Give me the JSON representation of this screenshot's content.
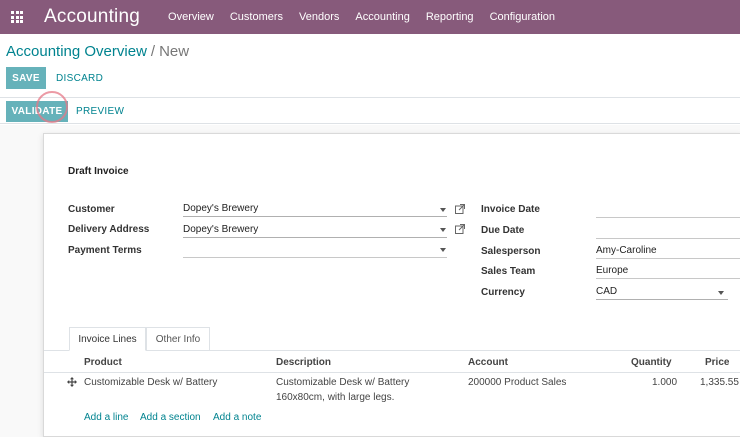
{
  "navbar": {
    "app_title": "Accounting",
    "menu": [
      "Overview",
      "Customers",
      "Vendors",
      "Accounting",
      "Reporting",
      "Configuration"
    ]
  },
  "breadcrumb": {
    "parent": "Accounting Overview",
    "separator": "/",
    "current": "New"
  },
  "buttons": {
    "save": "SAVE",
    "discard": "DISCARD",
    "validate": "VALIDATE",
    "preview": "PREVIEW"
  },
  "form": {
    "title": "Draft Invoice",
    "customer": {
      "label": "Customer",
      "value": "Dopey's Brewery"
    },
    "delivery_address": {
      "label": "Delivery Address",
      "value": "Dopey's Brewery"
    },
    "payment_terms": {
      "label": "Payment Terms",
      "value": ""
    },
    "invoice_date": {
      "label": "Invoice Date",
      "value": ""
    },
    "due_date": {
      "label": "Due Date",
      "value": ""
    },
    "salesperson": {
      "label": "Salesperson",
      "value": "Amy-Caroline"
    },
    "sales_team": {
      "label": "Sales Team",
      "value": "Europe"
    },
    "currency": {
      "label": "Currency",
      "value": "CAD"
    }
  },
  "tabs": [
    "Invoice Lines",
    "Other Info"
  ],
  "lines": {
    "headers": {
      "product": "Product",
      "description": "Description",
      "account": "Account",
      "quantity": "Quantity",
      "price": "Price"
    },
    "rows": [
      {
        "product": "Customizable Desk w/ Battery",
        "description_line1": "Customizable Desk w/ Battery",
        "description_line2": "160x80cm, with large legs.",
        "account": "200000 Product Sales",
        "quantity": "1.000",
        "price": "1,335.55"
      }
    ],
    "add_line": "Add a line",
    "add_section": "Add a section",
    "add_note": "Add a note"
  },
  "colors": {
    "navbar": "#875a7b",
    "primary_button": "#66b2ba",
    "link": "#00838f"
  }
}
